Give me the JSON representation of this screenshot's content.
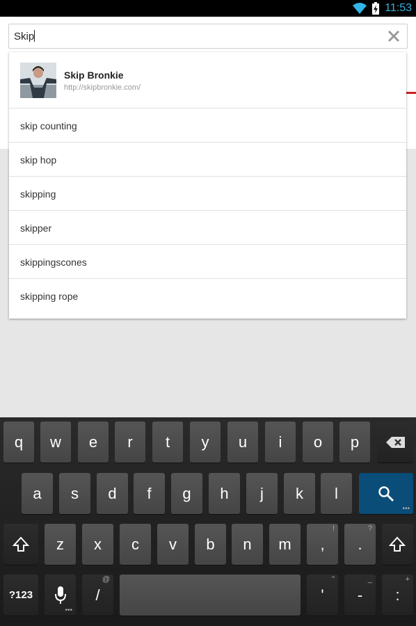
{
  "statusbar": {
    "time": "11:53"
  },
  "search": {
    "value": "Skip"
  },
  "suggestions": {
    "top": {
      "title": "Skip Bronkie",
      "url": "http://skipbronkie.com/"
    },
    "items": [
      "skip counting",
      "skip hop",
      "skipping",
      "skipper",
      "skippingscones",
      "skipping rope"
    ]
  },
  "keyboard": {
    "row1": [
      "q",
      "w",
      "e",
      "r",
      "t",
      "y",
      "u",
      "i",
      "o",
      "p"
    ],
    "row2": [
      "a",
      "s",
      "d",
      "f",
      "g",
      "h",
      "j",
      "k",
      "l"
    ],
    "row3": [
      "z",
      "x",
      "c",
      "v",
      "b",
      "n",
      "m",
      ",",
      "."
    ],
    "row3_hints": [
      "!",
      "?"
    ],
    "mode_key": "?123",
    "slash": "/",
    "slash_hint": "@",
    "apostrophe": "'",
    "apostrophe_hint": "\"",
    "dash": "-",
    "dash_hint": "_",
    "colon": ":",
    "colon_hint": "+"
  },
  "colors": {
    "accent": "#33b5e5",
    "search_key": "#0a4d78",
    "underline": "#cc2020"
  }
}
